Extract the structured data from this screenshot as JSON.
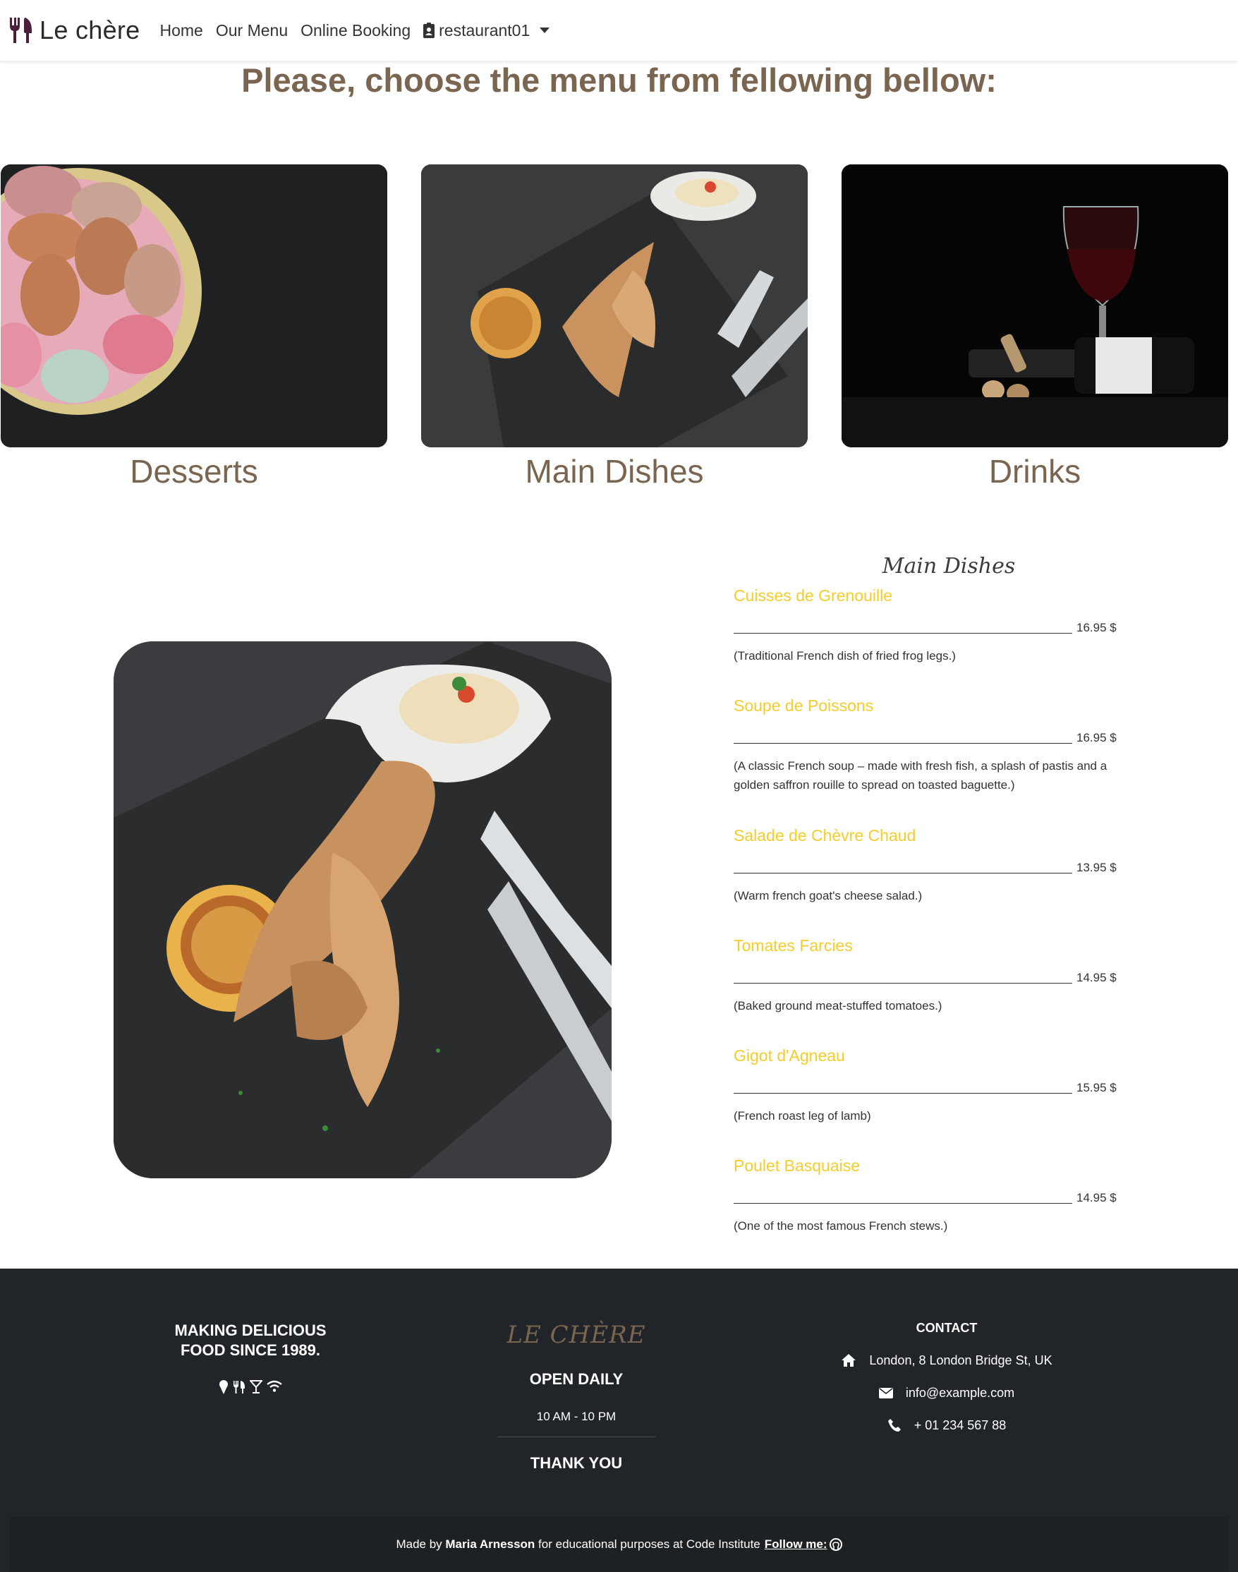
{
  "navbar": {
    "brand": "Le chère",
    "links": [
      "Home",
      "Our Menu",
      "Online Booking"
    ],
    "user": "restaurant01"
  },
  "heading": "Please, choose the menu from fellowing bellow:",
  "categories": [
    {
      "label": "Desserts"
    },
    {
      "label": "Main Dishes"
    },
    {
      "label": "Drinks"
    }
  ],
  "menu": {
    "title": "Main Dishes",
    "dishes": [
      {
        "name": "Cuisses de Grenouille",
        "price": "16.95 $",
        "description": "(Traditional French dish of fried frog legs.)"
      },
      {
        "name": "Soupe de Poissons",
        "price": "16.95 $",
        "description": "(A classic French soup – made with fresh fish, a splash of pastis and a golden saffron rouille to spread on toasted baguette.)"
      },
      {
        "name": "Salade de Chèvre Chaud",
        "price": "13.95 $",
        "description": "(Warm french goat's cheese salad.)"
      },
      {
        "name": "Tomates Farcies",
        "price": "14.95 $",
        "description": "(Baked ground meat-stuffed tomatoes.)"
      },
      {
        "name": "Gigot d'Agneau",
        "price": "15.95 $",
        "description": "(French roast leg of lamb)"
      },
      {
        "name": "Poulet Basquaise",
        "price": "14.95 $",
        "description": "(One of the most famous French stews.)"
      }
    ]
  },
  "footer": {
    "tagline_1": "MAKING DELICIOUS",
    "tagline_2": "FOOD SINCE 1989.",
    "logo": "LE CHÈRE",
    "open": "OPEN DAILY",
    "hours": "10 AM - 10 PM",
    "thanks": "THANK YOU",
    "contact_heading": "CONTACT",
    "address": "London, 8 London Bridge St, UK",
    "email": "info@example.com",
    "phone": "+ 01 234 567 88",
    "credit_prefix": "Made by",
    "credit_name": "Maria Arnesson",
    "credit_suffix": "for educational purposes at Code Institute",
    "follow": "Follow me:"
  },
  "colors": {
    "heading": "#7a6650",
    "dish_name": "#f3cd2b",
    "footer_bg": "#212529",
    "brand_icon": "#4a1f3a"
  }
}
